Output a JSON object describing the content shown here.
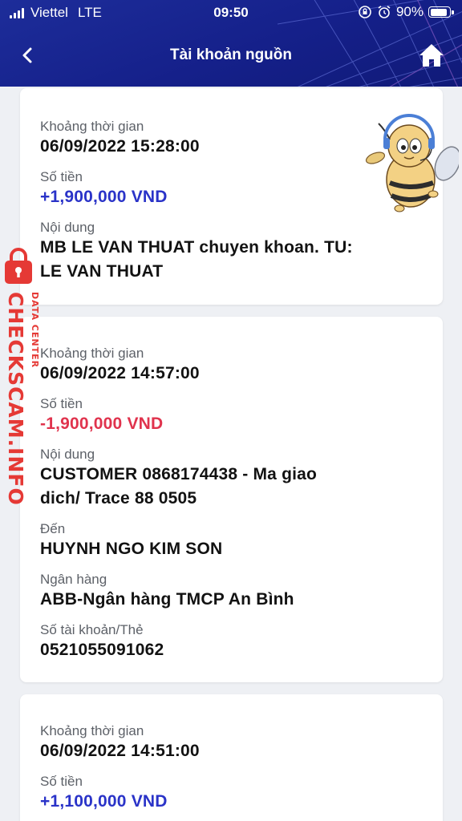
{
  "status_bar": {
    "carrier": "Viettel",
    "network": "LTE",
    "time": "09:50",
    "battery": "90%",
    "battery_level": 0.9
  },
  "nav": {
    "title": "Tài khoản nguồn",
    "back_icon": "chevron-left-icon",
    "home_icon": "home-icon"
  },
  "transactions": [
    {
      "time_label": "Khoảng thời gian",
      "time": "06/09/2022 15:28:00",
      "amount_label": "Số tiền",
      "amount": "+1,900,000 VND",
      "content_label": "Nội dung",
      "content_line1": "MB LE VAN THUAT chuyen khoan. TU:",
      "content_line2": "LE VAN THUAT"
    },
    {
      "time_label": "Khoảng thời gian",
      "time": "06/09/2022 14:57:00",
      "amount_label": "Số tiền",
      "amount": "-1,900,000 VND",
      "content_label": "Nội dung",
      "content_line1": "CUSTOMER 0868174438 - Ma giao",
      "content_line2": "dich/ Trace 88 0505",
      "to_label": "Đến",
      "to": "HUYNH NGO KIM SON",
      "bank_label": "Ngân hàng",
      "bank": "ABB-Ngân hàng TMCP An Bình",
      "account_label": "Số tài khoản/Thẻ",
      "account": "0521055091062"
    },
    {
      "time_label": "Khoảng thời gian",
      "time": "06/09/2022 14:51:00",
      "amount_label": "Số tiền",
      "amount": "+1,100,000 VND"
    }
  ],
  "watermark": {
    "main": "CHECKSCAM.INFO",
    "sub": "DATA CENTER"
  },
  "colors": {
    "header": "#15208a",
    "positive": "#2a33c8",
    "negative": "#e0334d",
    "watermark": "#e53935"
  }
}
